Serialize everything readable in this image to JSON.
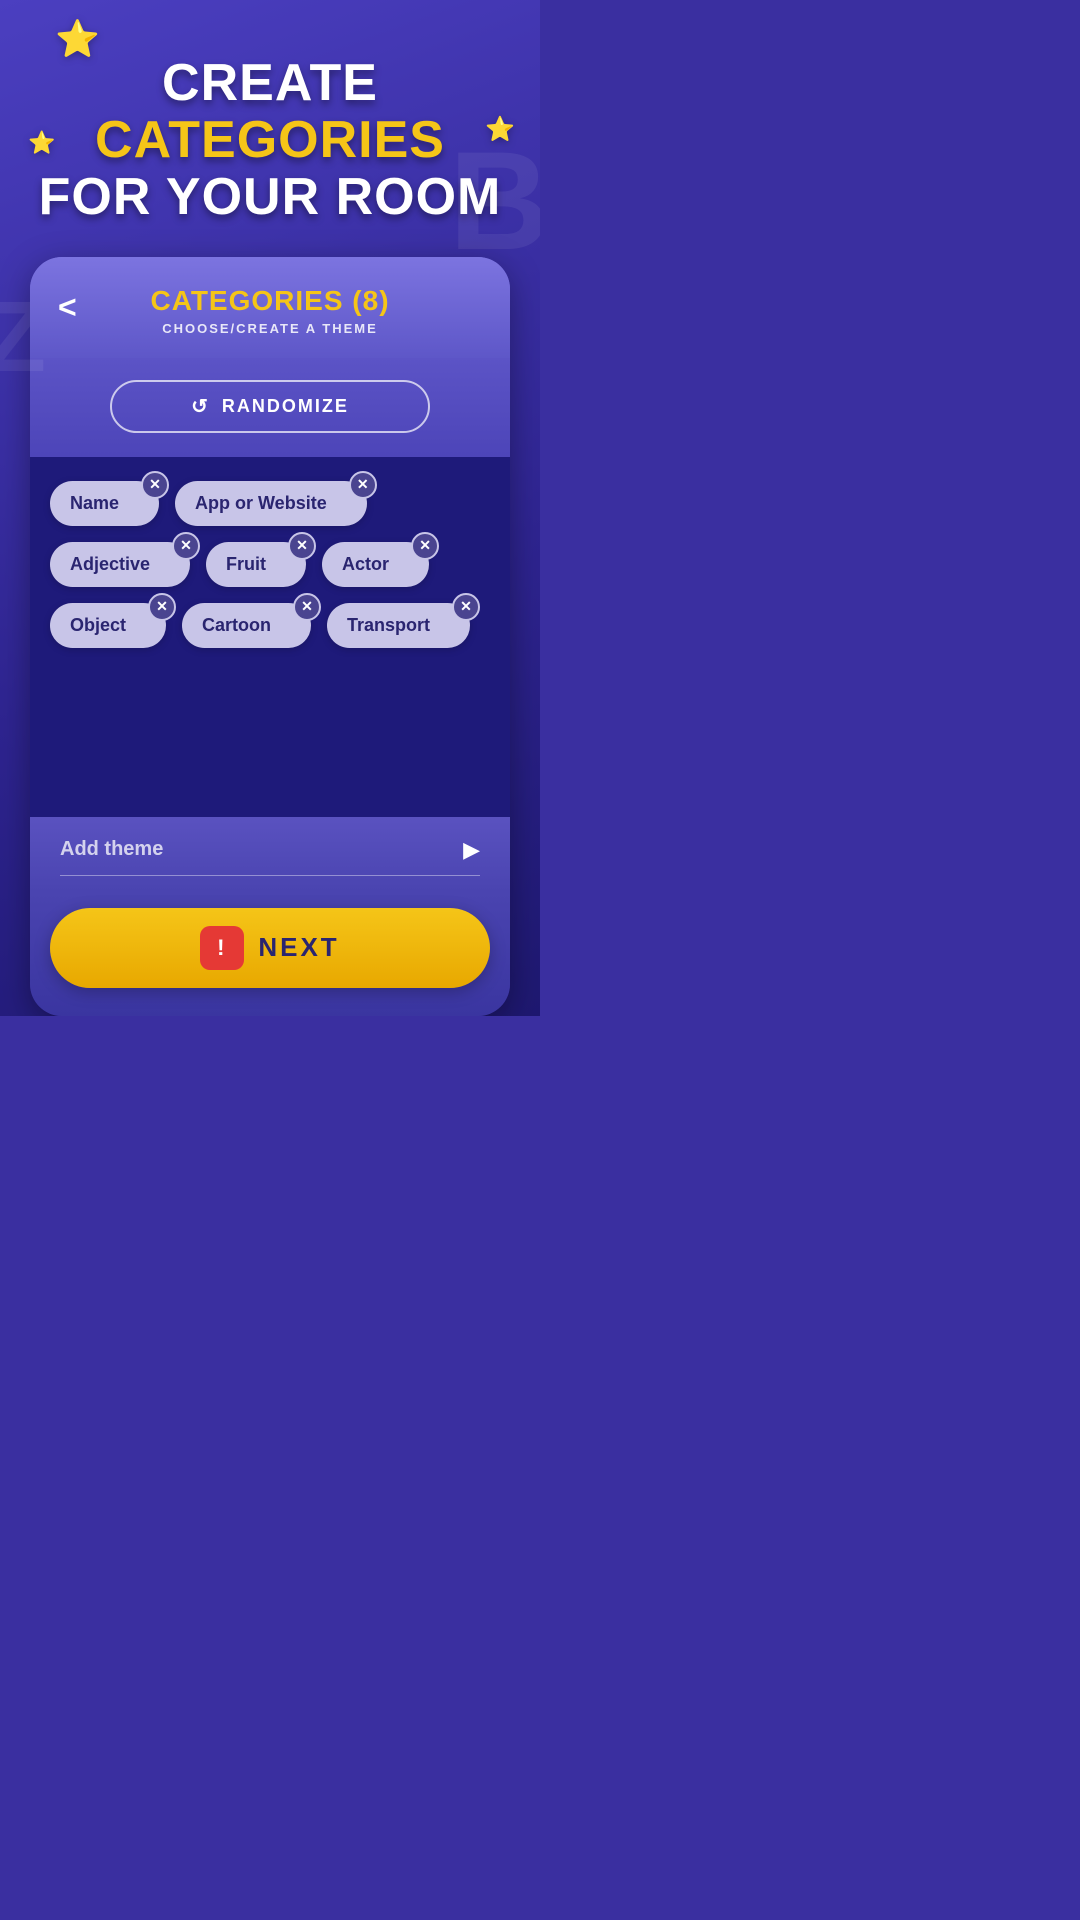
{
  "header": {
    "line1_white": "CREATE",
    "line1_yellow": "CATEGORIES",
    "line2": "FOR YOUR ROOM"
  },
  "card": {
    "title": "CATEGORIES (8)",
    "subtitle": "CHOOSE/CREATE A THEME",
    "back_label": "<"
  },
  "randomize": {
    "label": "RANDOMIZE",
    "icon": "↺"
  },
  "categories": [
    {
      "id": "name",
      "label": "Name"
    },
    {
      "id": "app-or-website",
      "label": "App or Website"
    },
    {
      "id": "adjective",
      "label": "Adjective"
    },
    {
      "id": "fruit",
      "label": "Fruit"
    },
    {
      "id": "actor",
      "label": "Actor"
    },
    {
      "id": "object",
      "label": "Object"
    },
    {
      "id": "cartoon",
      "label": "Cartoon"
    },
    {
      "id": "transport",
      "label": "Transport"
    }
  ],
  "add_theme": {
    "placeholder": "Add theme",
    "send_icon": "▶"
  },
  "next_button": {
    "label": "NEXT",
    "warning_symbol": "!"
  },
  "stars": [
    "⭐",
    "⭐",
    "⭐"
  ],
  "watermarks": [
    "B",
    "Z"
  ]
}
